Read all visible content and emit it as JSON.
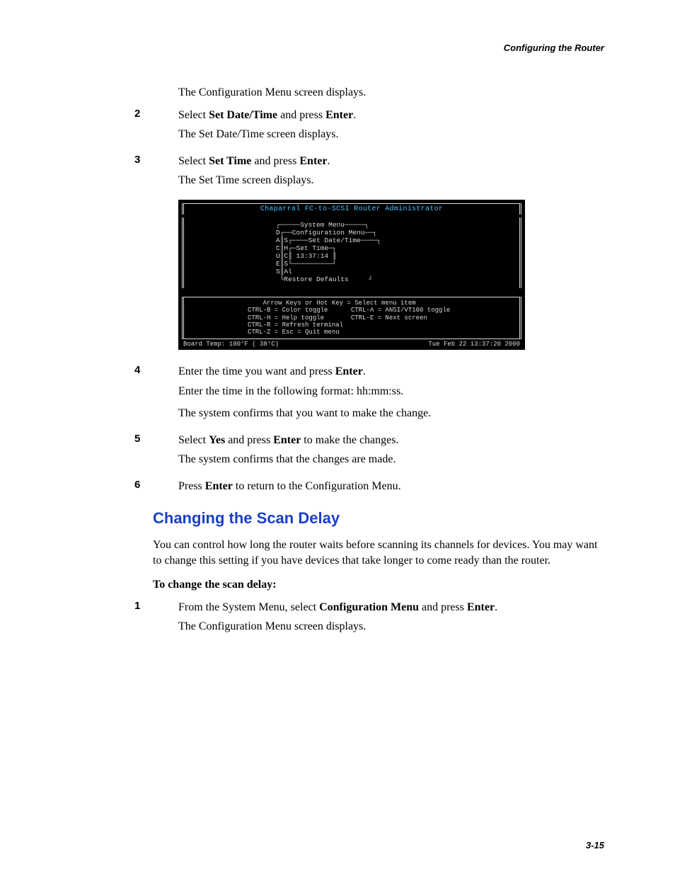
{
  "header": {
    "right": "Configuring the Router"
  },
  "body": {
    "intro1": "The Configuration Menu screen displays.",
    "step2": {
      "num": "2",
      "prefix": "Select ",
      "bold1": "Set Date/Time",
      "mid": " and press ",
      "bold2": "Enter",
      "suffix": ".",
      "follow": "The Set Date/Time screen displays."
    },
    "step3": {
      "num": "3",
      "prefix": "Select ",
      "bold1": "Set Time",
      "mid": " and press ",
      "bold2": "Enter",
      "suffix": ".",
      "follow": "The Set Time screen displays."
    },
    "step4": {
      "num": "4",
      "prefix": "Enter the time you want and press ",
      "bold1": "Enter",
      "suffix": ".",
      "follow1": "Enter the time in the following format: hh:mm:ss.",
      "follow2": "The system confirms that you want to make the change."
    },
    "step5": {
      "num": "5",
      "prefix": "Select ",
      "bold1": "Yes",
      "mid": " and press ",
      "bold2": "Enter",
      "suffix": " to make the changes.",
      "follow": "The system confirms that the changes are made."
    },
    "step6": {
      "num": "6",
      "prefix": "Press ",
      "bold1": "Enter",
      "suffix": " to return to the Configuration Menu."
    }
  },
  "terminal": {
    "title": "Chaparral FC-to-SCSI Router Administrator",
    "menu_text": "┌─────System Menu─────┐\nD┌──Configuration Menu──┐\nA║S┌────Set Date/Time────┐\nC║H┌─Set Time─┐\nU║C║ 13:37:14 ║\nE║S└──────────┘\nS║Al\n └Restore Defaults     ┘",
    "help_text": "    Arrow Keys or Hot Key = Select menu item\nCTRL-B = Color toggle      CTRL-A = ANSI/VT100 toggle\nCTRL-H = Help toggle       CTRL-E = Next screen\nCTRL-R = Refresh terminal\nCTRL-Z = Esc = Quit menu",
    "status_left": "Board Temp: 100°F ( 38°C)",
    "status_right": "Tue Feb 22 13:37:20 2000"
  },
  "section2": {
    "heading": "Changing the Scan Delay",
    "intro": "You can control how long the router waits before scanning its channels for devices. You may want to change this setting if you have devices that take longer to come ready than the router.",
    "subhead_prefix": "To change the scan delay",
    "subhead_suffix": ":",
    "step1": {
      "num": "1",
      "prefix": "From the System Menu, select ",
      "bold1": "Configuration Menu",
      "mid": " and press ",
      "bold2": "Enter",
      "suffix": ".",
      "follow": "The Configuration Menu screen displays."
    }
  },
  "footer": {
    "pagenum": "3-15"
  }
}
